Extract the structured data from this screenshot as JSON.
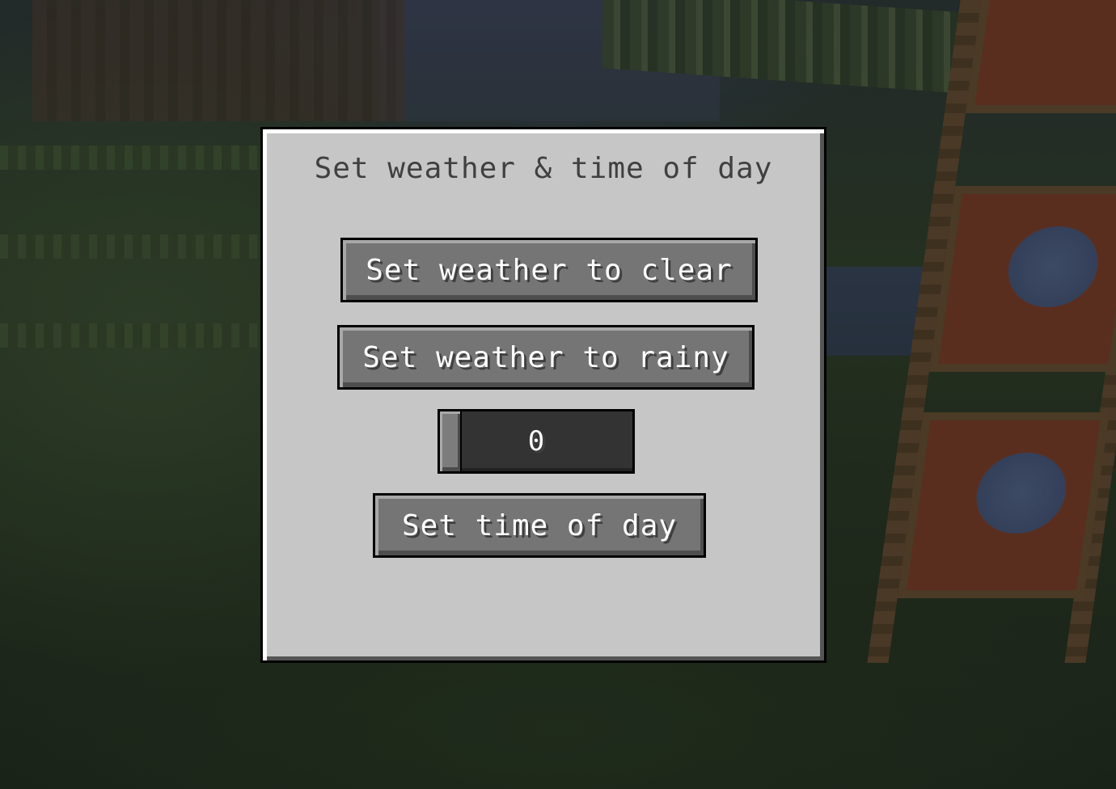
{
  "dialog": {
    "title": "Set weather & time of day",
    "buttons": {
      "weather_clear": "Set weather to clear",
      "weather_rainy": "Set weather to rainy",
      "time_of_day": "Set time of day"
    },
    "time_slider": {
      "value": "0"
    }
  },
  "colors": {
    "panel_bg": "#c6c6c6",
    "button_bg": "#757575",
    "slider_bg": "#333333",
    "title_text": "#404040",
    "button_text": "#ffffff"
  }
}
